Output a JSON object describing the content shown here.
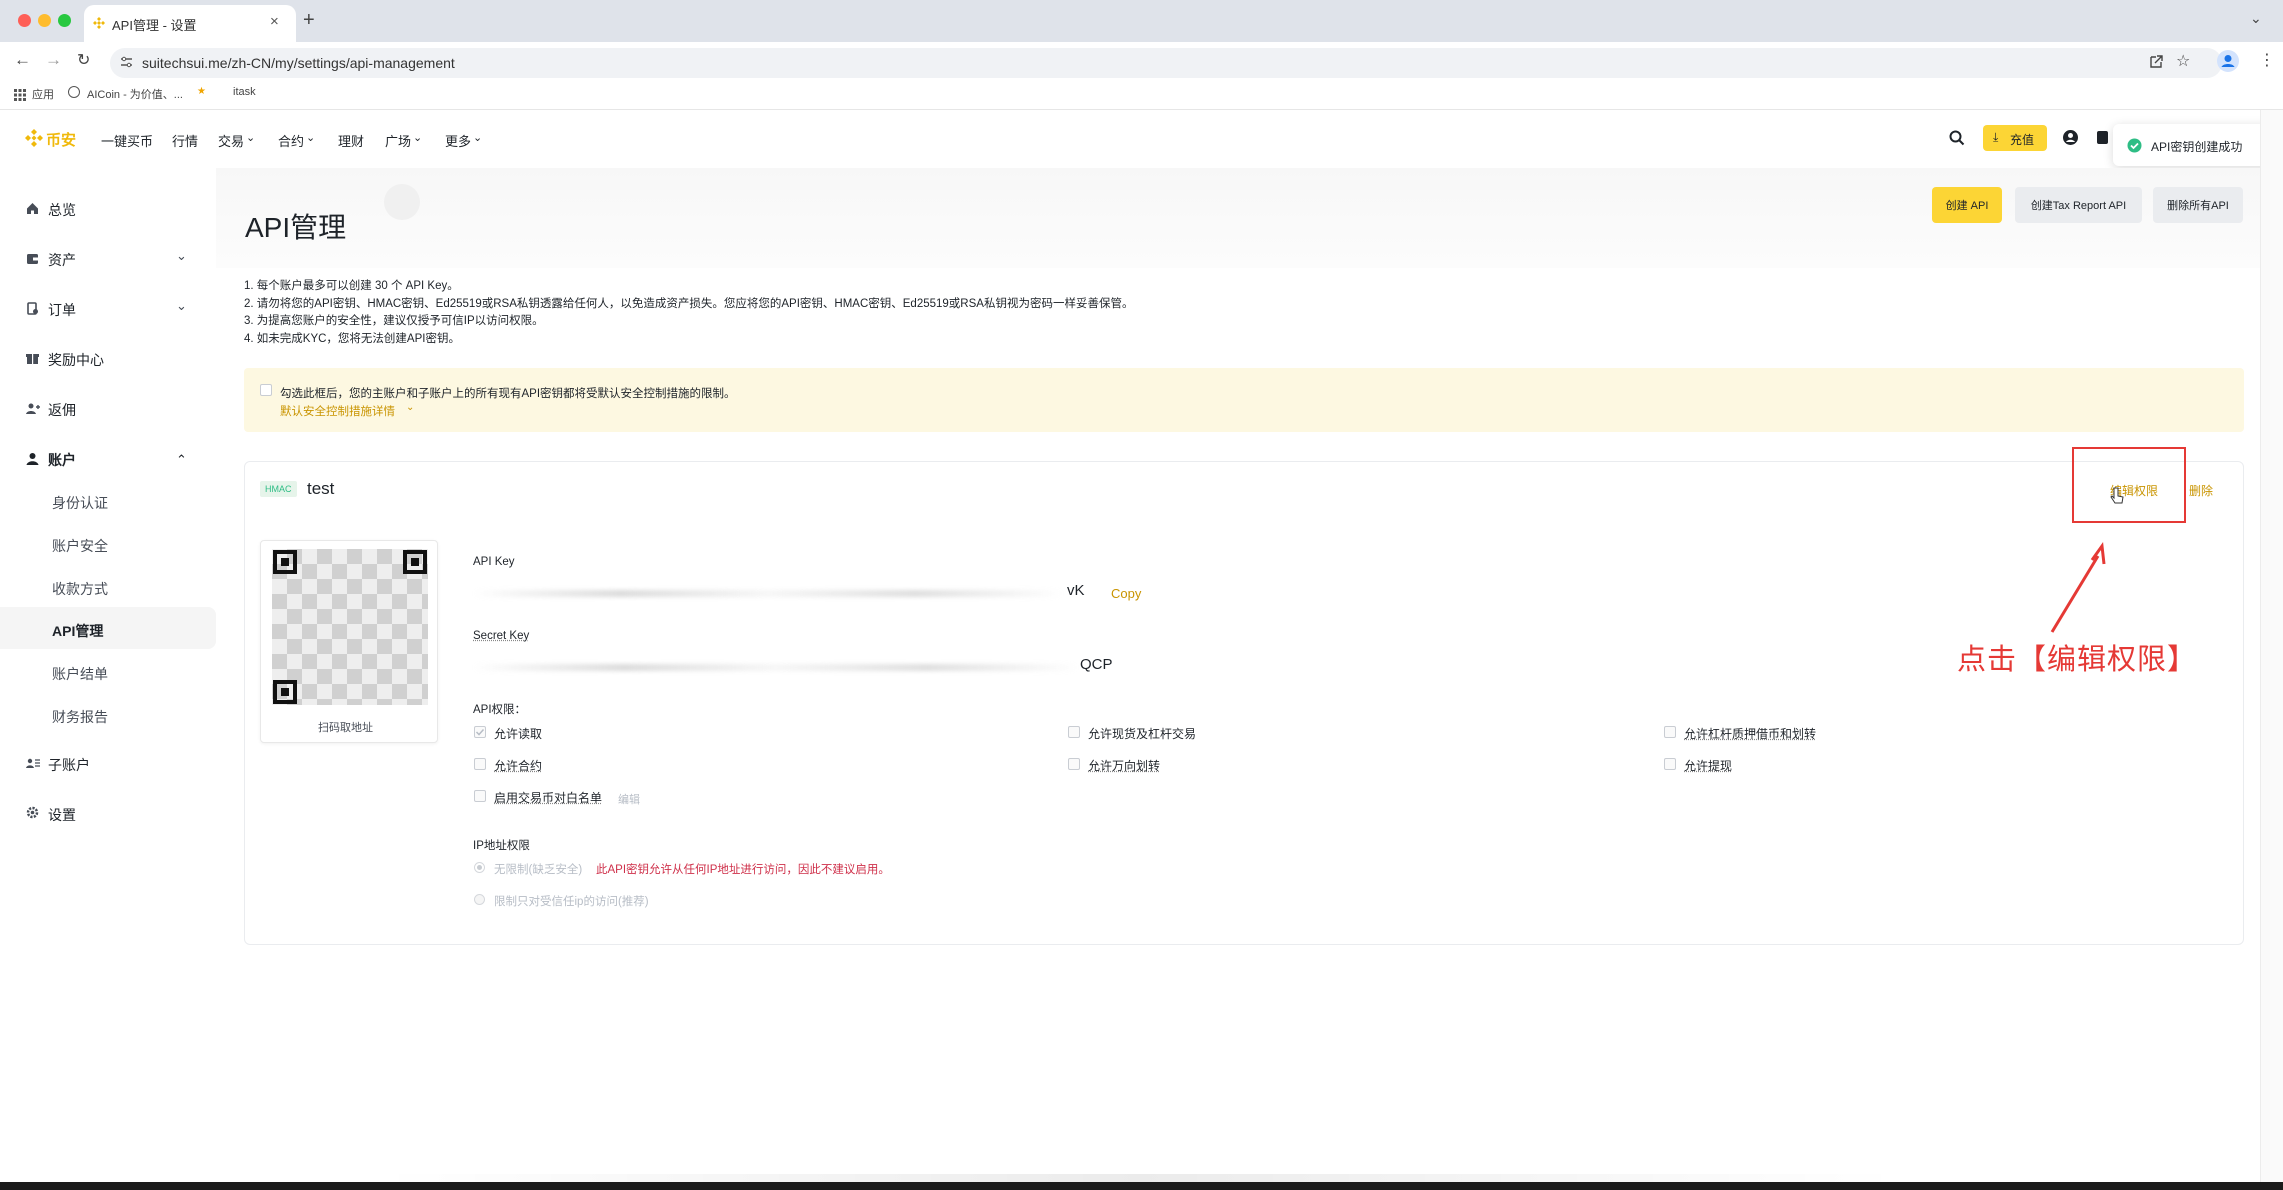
{
  "browser": {
    "tab_title": "API管理 - 设置",
    "url": "suitechsui.me/zh-CN/my/settings/api-management",
    "bookmarks": [
      "应用",
      "AICoin - 为价值、...",
      "itask"
    ]
  },
  "brand": {
    "name": "币安",
    "accent": "#f0b90b"
  },
  "topnav": {
    "items": [
      "一键买币",
      "行情",
      "交易",
      "合约",
      "理财",
      "广场",
      "更多"
    ],
    "deposit_label": "充值",
    "toast": "API密钥创建成功"
  },
  "sidebar": {
    "items": [
      {
        "label": "总览",
        "icon": "home-icon"
      },
      {
        "label": "资产",
        "icon": "wallet-icon"
      },
      {
        "label": "订单",
        "icon": "orders-icon"
      },
      {
        "label": "奖励中心",
        "icon": "reward-icon"
      },
      {
        "label": "返佣",
        "icon": "referral-icon"
      },
      {
        "label": "账户",
        "icon": "user-icon"
      }
    ],
    "sub_items": [
      "身份认证",
      "账户安全",
      "收款方式",
      "API管理",
      "账户结单",
      "财务报告"
    ],
    "bottom_items": [
      {
        "label": "子账户",
        "icon": "subaccount-icon"
      },
      {
        "label": "设置",
        "icon": "gear-icon"
      }
    ]
  },
  "page": {
    "title": "API管理",
    "buttons": {
      "create": "创建 API",
      "tax": "创建Tax Report API",
      "delete_all": "删除所有API"
    },
    "notes": [
      "1. 每个账户最多可以创建 30 个 API Key。",
      "2. 请勿将您的API密钥、HMAC密钥、Ed25519或RSA私钥透露给任何人，以免造成资产损失。您应将您的API密钥、HMAC密钥、Ed25519或RSA私钥视为密码一样妥善保管。",
      "3. 为提高您账户的安全性，建议仅授予可信IP以访问权限。",
      "4. 如未完成KYC，您将无法创建API密钥。"
    ],
    "warning": {
      "text": "勾选此框后，您的主账户和子账户上的所有现有API密钥都将受默认安全控制措施的限制。",
      "link": "默认安全控制措施详情"
    }
  },
  "api_card": {
    "tag": "HMAC",
    "name": "test",
    "edit_label": "编辑权限",
    "delete_label": "删除",
    "qr_caption": "扫码取地址",
    "api_key_label": "API Key",
    "api_key_tail": "vK",
    "copy_label": "Copy",
    "secret_key_label": "Secret Key",
    "secret_key_tail": "QCP",
    "permissions_label": "API权限：",
    "permissions": [
      {
        "label": "允许读取",
        "checked": true
      },
      {
        "label": "允许现货及杠杆交易",
        "checked": false
      },
      {
        "label": "允许杠杆质押借币和划转",
        "checked": false
      },
      {
        "label": "允许合约",
        "checked": false
      },
      {
        "label": "允许万向划转",
        "checked": false
      },
      {
        "label": "允许提现",
        "checked": false
      },
      {
        "label": "启用交易币对白名单",
        "checked": false
      }
    ],
    "whitelist_edit": "编辑",
    "ip_label": "IP地址权限",
    "ip_unrestricted": "无限制(缺乏安全)",
    "ip_warning": "此API密钥允许从任何IP地址进行访问，因此不建议启用。",
    "ip_restricted": "限制只对受信任ip的访问(推荐)"
  },
  "annotation": {
    "text": "点击【编辑权限】",
    "color": "#e53935"
  }
}
